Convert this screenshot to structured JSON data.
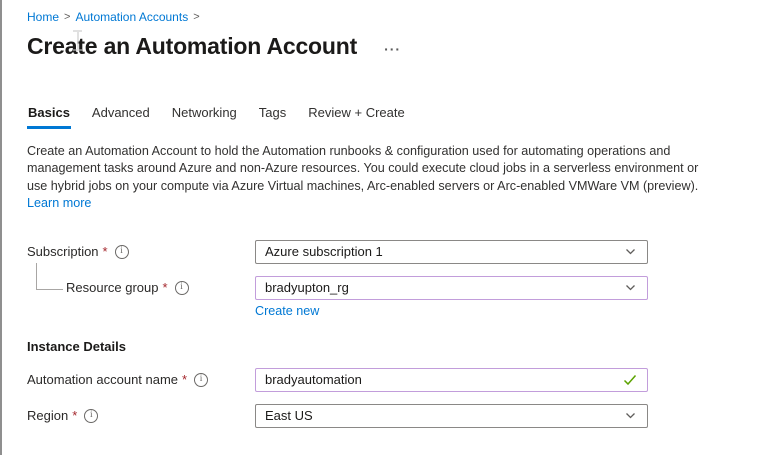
{
  "breadcrumb": {
    "separator": ">",
    "items": [
      {
        "label": "Home"
      },
      {
        "label": "Automation Accounts"
      }
    ]
  },
  "header": {
    "title": "Create an Automation Account",
    "ellipsis": "···"
  },
  "tabs": [
    {
      "label": "Basics",
      "active": true
    },
    {
      "label": "Advanced",
      "active": false
    },
    {
      "label": "Networking",
      "active": false
    },
    {
      "label": "Tags",
      "active": false
    },
    {
      "label": "Review + Create",
      "active": false
    }
  ],
  "intro": {
    "lines": [
      "Create an Automation Account to hold the Automation runbooks & configuration used for automating operations and",
      "management tasks around Azure and non-Azure resources. You could execute cloud jobs in a serverless environment or",
      "use hybrid jobs on your compute via Azure Virtual machines, Arc-enabled servers or Arc-enabled VMWare VM (preview)."
    ],
    "learn_more": "Learn more"
  },
  "form": {
    "required_marker": "*",
    "subscription": {
      "label": "Subscription",
      "value": "Azure subscription 1"
    },
    "resource_group": {
      "label": "Resource group",
      "value": "bradyupton_rg",
      "create_new": "Create new"
    },
    "section_heading": "Instance Details",
    "account_name": {
      "label": "Automation account name",
      "value": "bradyautomation"
    },
    "region": {
      "label": "Region",
      "value": "East US"
    }
  },
  "icons": {
    "info_glyph": "i"
  },
  "colors": {
    "accent_blue": "#0078d4",
    "dirty_field_border": "#c29ddb",
    "valid_green": "#5ca300",
    "required_red": "#a4262c"
  }
}
